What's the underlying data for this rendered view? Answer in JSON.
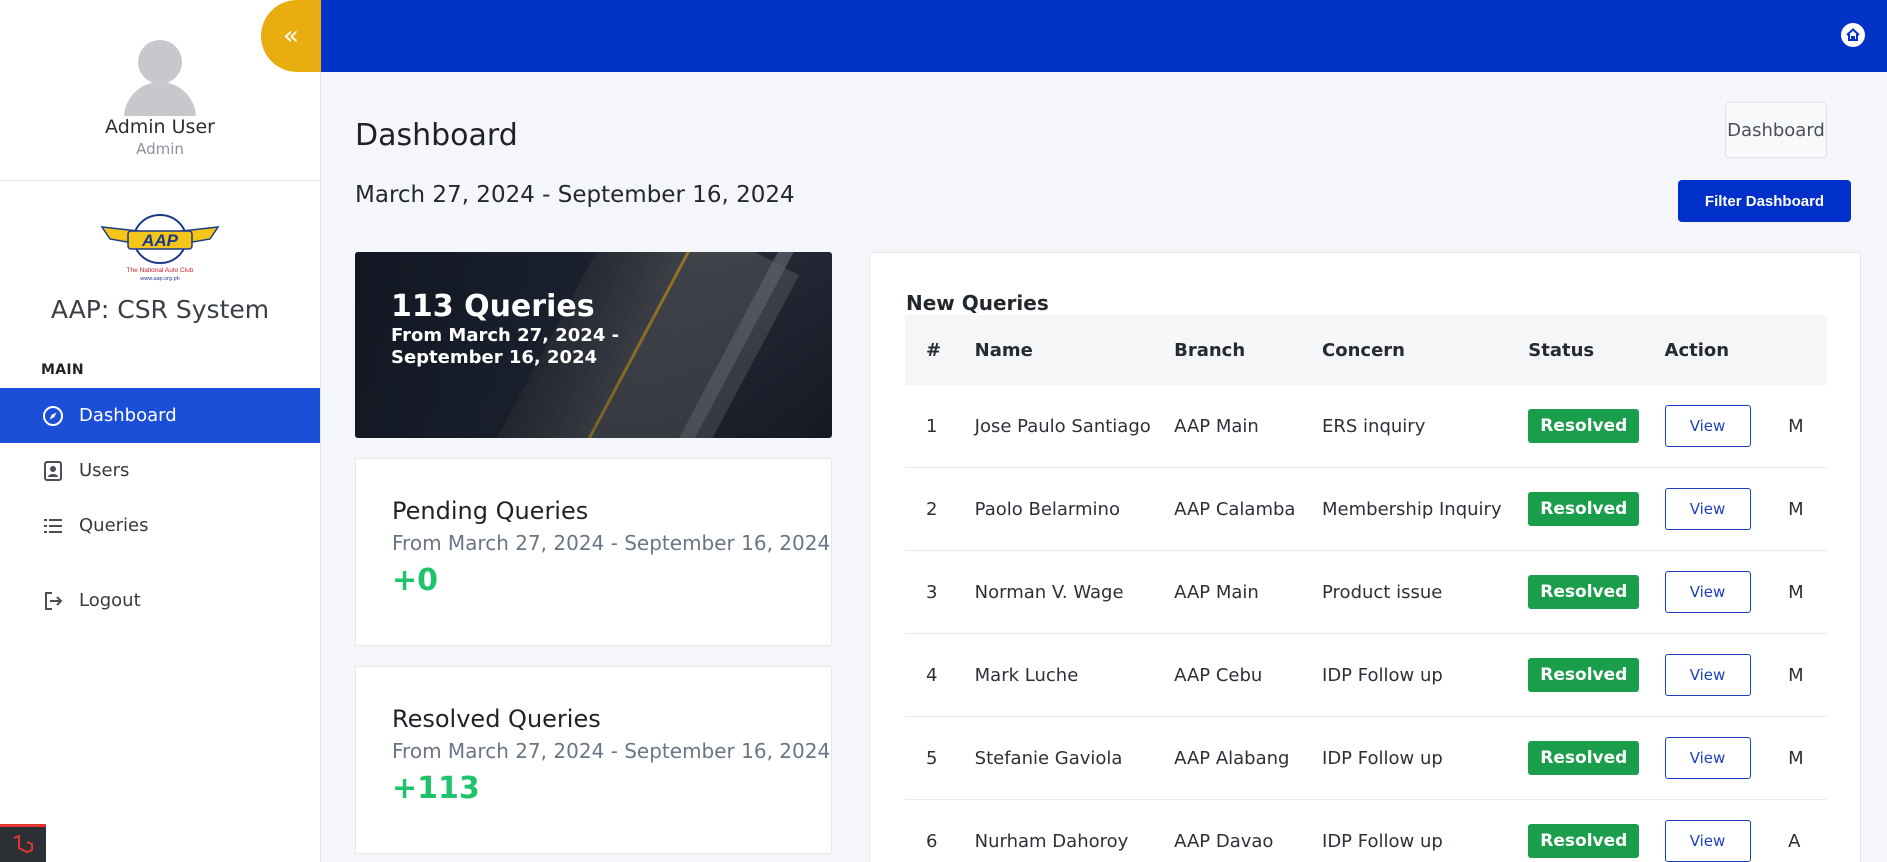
{
  "sidebar": {
    "profile": {
      "name": "Admin User",
      "role": "Admin"
    },
    "brand": {
      "logo_text": "AAP",
      "logo_tagline": "The National Auto Club",
      "logo_url": "www.aap.org.ph",
      "title": "AAP: CSR System"
    },
    "section_label": "MAIN",
    "nav": [
      {
        "label": "Dashboard",
        "icon": "compass-icon",
        "active": true
      },
      {
        "label": "Users",
        "icon": "contacts-icon",
        "active": false
      },
      {
        "label": "Queries",
        "icon": "list-icon",
        "active": false
      }
    ],
    "logout_label": "Logout",
    "toggle_glyph": "«"
  },
  "topbar": {
    "home_icon": "home-icon",
    "color": "#0033c6"
  },
  "header": {
    "title": "Dashboard",
    "breadcrumb": "Dashboard",
    "date_range": "March 27, 2024 - September 16, 2024",
    "filter_label": "Filter Dashboard"
  },
  "cards": {
    "total": {
      "title": "113 Queries",
      "subtitle": "From March 27, 2024 - September 16, 2024"
    },
    "pending": {
      "title": "Pending Queries",
      "subtitle": "From March 27, 2024 - September 16, 2024",
      "value": "+0"
    },
    "resolved": {
      "title": "Resolved Queries",
      "subtitle": "From March 27, 2024 - September 16, 2024",
      "value": "+113"
    }
  },
  "table": {
    "title": "New Queries",
    "columns": [
      "#",
      "Name",
      "Branch",
      "Concern",
      "Status",
      "Action"
    ],
    "view_label": "View",
    "rows": [
      {
        "num": "1",
        "name": "Jose Paulo Santiago",
        "branch": "AAP Main",
        "concern": "ERS inquiry",
        "status": "Resolved",
        "extra": "M"
      },
      {
        "num": "2",
        "name": "Paolo Belarmino",
        "branch": "AAP Calamba",
        "concern": "Membership Inquiry",
        "status": "Resolved",
        "extra": "M"
      },
      {
        "num": "3",
        "name": "Norman V. Wage",
        "branch": "AAP Main",
        "concern": "Product issue",
        "status": "Resolved",
        "extra": "M"
      },
      {
        "num": "4",
        "name": "Mark Luche",
        "branch": "AAP Cebu",
        "concern": "IDP Follow up",
        "status": "Resolved",
        "extra": "M"
      },
      {
        "num": "5",
        "name": "Stefanie Gaviola",
        "branch": "AAP Alabang",
        "concern": "IDP Follow up",
        "status": "Resolved",
        "extra": "M"
      },
      {
        "num": "6",
        "name": "Nurham Dahoroy",
        "branch": "AAP Davao",
        "concern": "IDP Follow up",
        "status": "Resolved",
        "extra": "A"
      }
    ]
  }
}
